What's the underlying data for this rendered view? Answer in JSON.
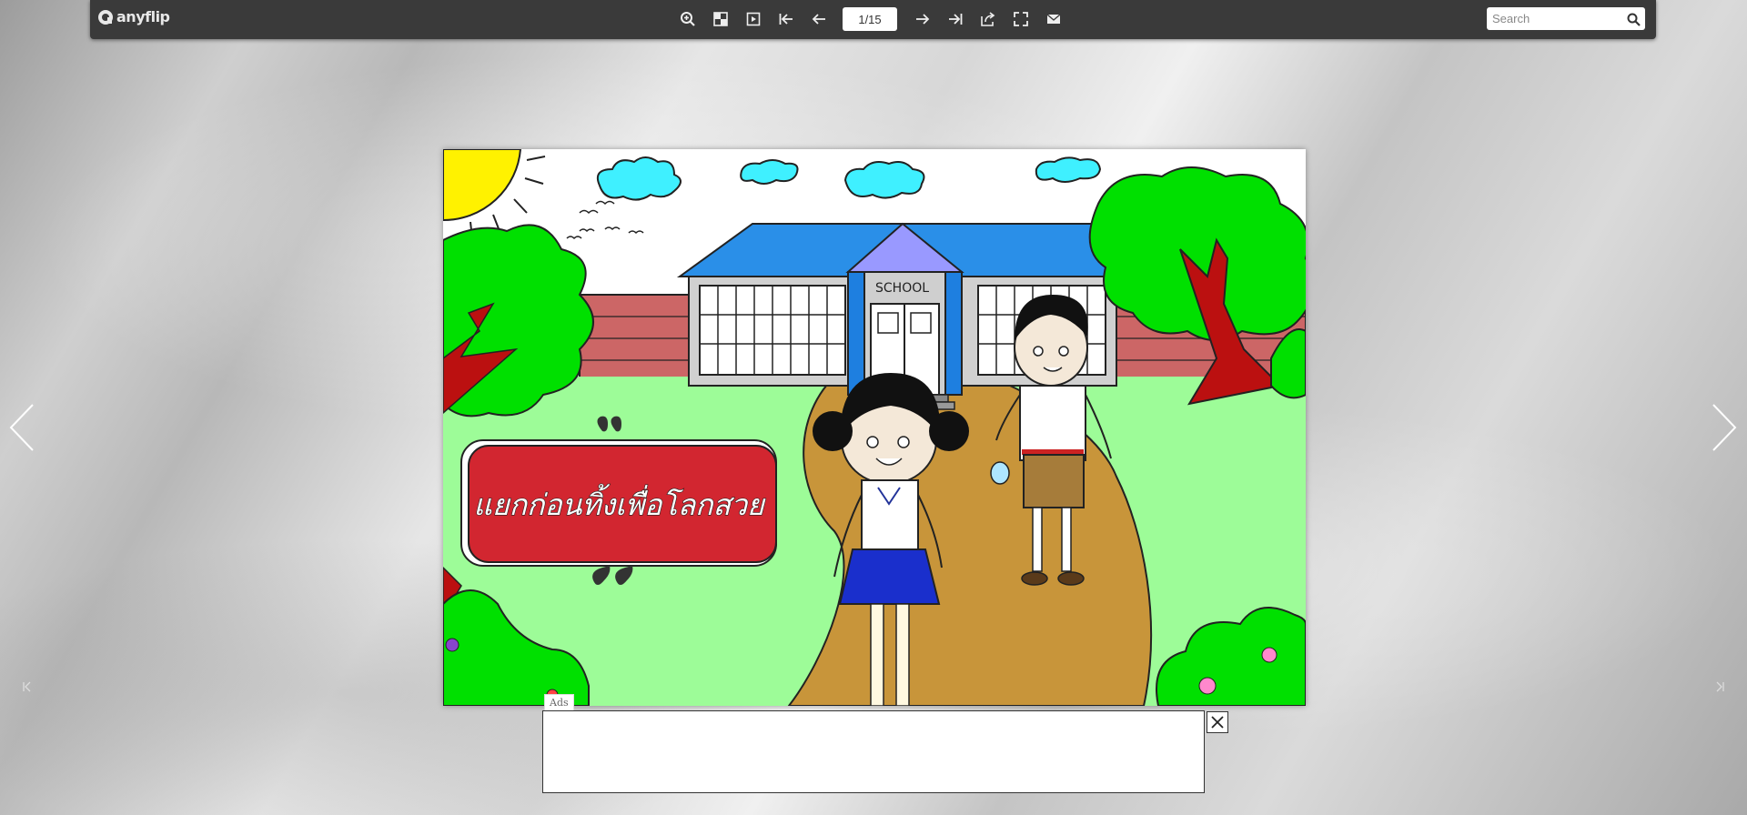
{
  "app": {
    "logo_text": "anyflip"
  },
  "toolbar": {
    "buttons": [
      {
        "name": "zoom-in-button",
        "icon": "zoom-in-icon"
      },
      {
        "name": "thumbnails-button",
        "icon": "grid-icon"
      },
      {
        "name": "single-page-button",
        "icon": "single-page-icon"
      },
      {
        "name": "first-page-button",
        "icon": "first-page-icon"
      },
      {
        "name": "previous-page-button",
        "icon": "arrow-left-icon"
      },
      {
        "name": "next-page-button",
        "icon": "arrow-right-icon"
      },
      {
        "name": "last-page-button",
        "icon": "last-page-icon"
      },
      {
        "name": "share-button",
        "icon": "share-icon"
      },
      {
        "name": "fullscreen-button",
        "icon": "fullscreen-icon"
      },
      {
        "name": "email-button",
        "icon": "mail-icon"
      }
    ],
    "page_indicator": "1/15",
    "search": {
      "placeholder": "Search"
    }
  },
  "book": {
    "title_text": "แยกก่อนทิ้งเพื่อโลกสวย",
    "school_sign": "SCHOOL"
  },
  "ad": {
    "label": "Ads"
  },
  "colors": {
    "toolbar_bg": "#3a3a3a",
    "speech_bubble": "#d22630",
    "sky_building_roof": "#2a8fe8",
    "grass": "#9dfc98",
    "path": "#c8953a"
  }
}
